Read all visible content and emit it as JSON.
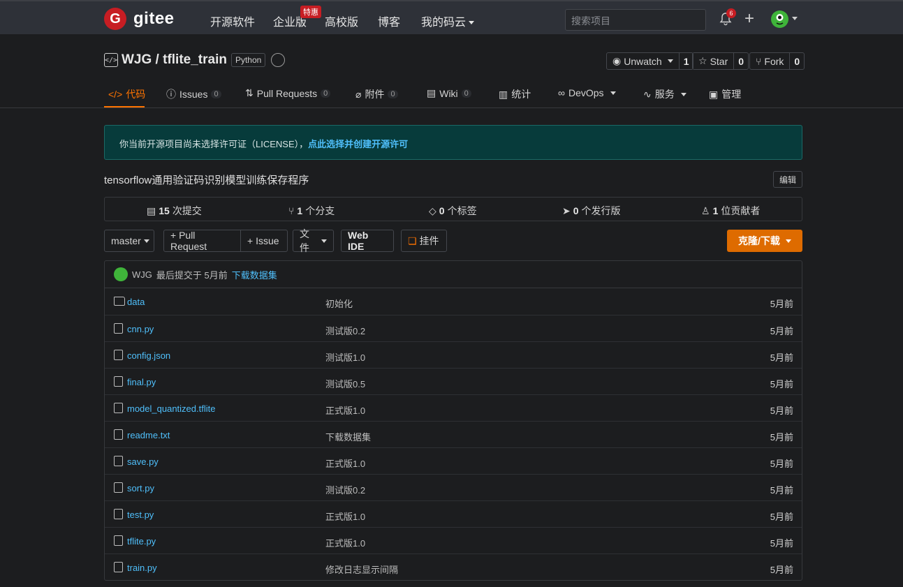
{
  "topbar": {
    "logo_text": "gitee",
    "nav": [
      "开源软件",
      "企业版",
      "高校版",
      "博客",
      "我的码云"
    ],
    "special_badge": "特惠",
    "search_placeholder": "搜索项目",
    "notification_count": "6"
  },
  "repo": {
    "title": "WJG / tflite_train",
    "language": "Python",
    "watch_label": "Unwatch",
    "watch_count": "1",
    "star_label": "Star",
    "star_count": "0",
    "fork_label": "Fork",
    "fork_count": "0"
  },
  "tabs": [
    {
      "label": "代码"
    },
    {
      "label": "Issues",
      "count": "0"
    },
    {
      "label": "Pull Requests",
      "count": "0"
    },
    {
      "label": "附件",
      "count": "0"
    },
    {
      "label": "Wiki",
      "count": "0"
    },
    {
      "label": "统计"
    },
    {
      "label": "DevOps"
    },
    {
      "label": "服务"
    },
    {
      "label": "管理"
    }
  ],
  "license_notice": {
    "text": "你当前开源项目尚未选择许可证（LICENSE），",
    "link": "点此选择并创建开源许可"
  },
  "description": "tensorflow通用验证码识别模型训练保存程序",
  "edit_label": "编辑",
  "stats": {
    "commits_num": "15",
    "commits_label": "次提交",
    "branches_num": "1",
    "branches_label": "个分支",
    "tags_num": "0",
    "tags_label": "个标签",
    "releases_num": "0",
    "releases_label": "个发行版",
    "contributors_num": "1",
    "contributors_label": "位贡献者"
  },
  "toolbar": {
    "branch": "master",
    "pull_request": "+ Pull Request",
    "issue": "+ Issue",
    "file": "文件",
    "web_ide": "Web IDE",
    "widget": "挂件",
    "clone": "克隆/下载"
  },
  "last_commit": {
    "user": "WJG",
    "text": "最后提交于 5月前",
    "message": "下载数据集"
  },
  "files": [
    {
      "name": "data",
      "message": "初始化",
      "time": "5月前"
    },
    {
      "name": "cnn.py",
      "message": "测试版0.2",
      "time": "5月前"
    },
    {
      "name": "config.json",
      "message": "测试版1.0",
      "time": "5月前"
    },
    {
      "name": "final.py",
      "message": "测试版0.5",
      "time": "5月前"
    },
    {
      "name": "model_quantized.tflite",
      "message": "正式版1.0",
      "time": "5月前"
    },
    {
      "name": "readme.txt",
      "message": "下载数据集",
      "time": "5月前"
    },
    {
      "name": "save.py",
      "message": "正式版1.0",
      "time": "5月前"
    },
    {
      "name": "sort.py",
      "message": "测试版0.2",
      "time": "5月前"
    },
    {
      "name": "test.py",
      "message": "正式版1.0",
      "time": "5月前"
    },
    {
      "name": "tflite.py",
      "message": "正式版1.0",
      "time": "5月前"
    },
    {
      "name": "train.py",
      "message": "修改日志显示间隔",
      "time": "5月前"
    }
  ]
}
